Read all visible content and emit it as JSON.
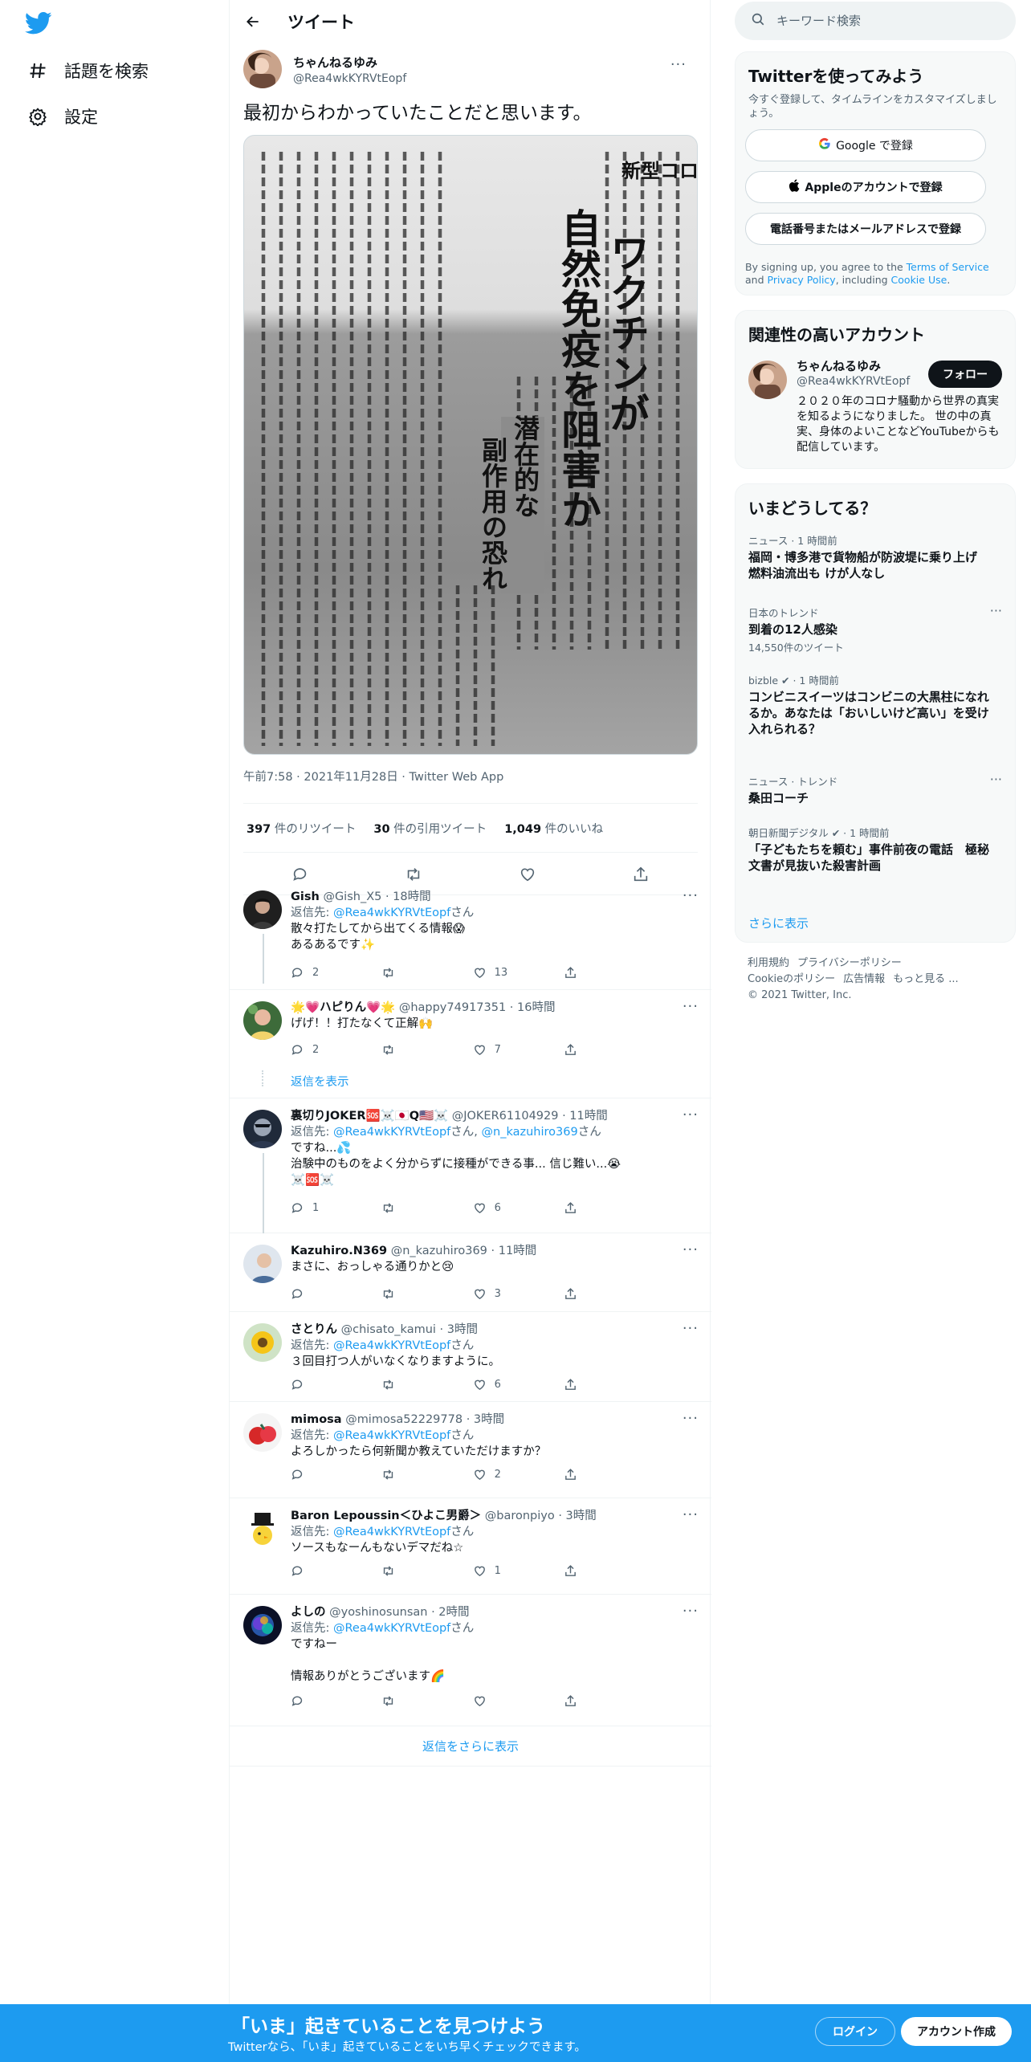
{
  "nav": {
    "explore_label": "話題を検索",
    "settings_label": "設定"
  },
  "header": {
    "title": "ツイート"
  },
  "main_tweet": {
    "name": "ちゃんねるゆみ",
    "handle": "@Rea4wkKYRVtEopf",
    "text": "最初からわかっていたことだと思います。",
    "image": {
      "kicker": "新型コロナ",
      "headline": [
        "ワクチンが",
        "自然免疫を阻害か"
      ],
      "subhead": [
        "潜在的な",
        "副作用の恐れ"
      ],
      "body_text": "スウェーデン・ストックホルム大学分子生物学部などの研究チームによると、新型コロナウイルスは、感染した人のDNAの修復を損ない、抗体を作る遺伝子の組み換え作用を妨げることが分かった。ヒトを含む脊椎動物は、三つの遺伝子の断片を組み換えて1億種類以上の抗体を作る。"
    },
    "meta": "午前7:58 · 2021年11月28日 · Twitter Web App",
    "stats": {
      "retweets_num": "397",
      "retweets_label": " 件のリツイート",
      "quotes_num": "30",
      "quotes_label": " 件の引用ツイート",
      "likes_num": "1,049",
      "likes_label": " 件のいいね"
    }
  },
  "replies": [
    {
      "name": "Gish",
      "handle": "@Gish_X5",
      "time": " · 18時間",
      "to_prefix": "返信先: ",
      "to": "@Rea4wkKYRVtEopf",
      "to_suffix": "さん",
      "lines": [
        "散々打たしてから出てくる情報😱",
        "あるあるです✨"
      ],
      "reply_count": "2",
      "rt_count": "",
      "like_count": "13"
    },
    {
      "name": "🌟💗ハピりん💗🌟",
      "handle": "@happy74917351",
      "time": " · 16時間",
      "lines": [
        "げげ！！打たなくて正解🙌"
      ],
      "reply_count": "2",
      "rt_count": "",
      "like_count": "7",
      "show_replies": "返信を表示"
    },
    {
      "name": "裏切りJOKER🆘☠️🇯🇵Q🇺🇸☠️",
      "handle": "@JOKER61104929",
      "time": " · 11時間",
      "to_prefix": "返信先: ",
      "to": "@Rea4wkKYRVtEopf",
      "to_suffix": "さん, ",
      "to2": "@n_kazuhiro369",
      "to2_suffix": "さん",
      "lines": [
        "ですね...💦",
        "治験中のものをよく分からずに接種ができる事... 信じ難い...😭",
        "☠️🆘☠️"
      ],
      "reply_count": "1",
      "rt_count": "",
      "like_count": "6"
    },
    {
      "name": "Kazuhiro.N369",
      "handle": "@n_kazuhiro369",
      "time": " · 11時間",
      "lines": [
        "まさに、おっしゃる通りかと😢"
      ],
      "reply_count": "",
      "rt_count": "",
      "like_count": "3"
    },
    {
      "name": "さとりん",
      "handle": "@chisato_kamui",
      "time": " · 3時間",
      "to_prefix": "返信先: ",
      "to": "@Rea4wkKYRVtEopf",
      "to_suffix": "さん",
      "lines": [
        "３回目打つ人がいなくなりますように。"
      ],
      "reply_count": "",
      "rt_count": "",
      "like_count": "6"
    },
    {
      "name": "mimosa",
      "handle": "@mimosa52229778",
      "time": " · 3時間",
      "to_prefix": "返信先: ",
      "to": "@Rea4wkKYRVtEopf",
      "to_suffix": "さん",
      "lines": [
        "よろしかったら何新聞か教えていただけますか？"
      ],
      "reply_count": "",
      "rt_count": "",
      "like_count": "2"
    },
    {
      "name": "Baron Lepoussin＜ひよこ男爵＞",
      "handle": "@baronpiyo",
      "time": " · 3時間",
      "to_prefix": "返信先: ",
      "to": "@Rea4wkKYRVtEopf",
      "to_suffix": "さん",
      "lines": [
        "ソースもなーんもないデマだね☆"
      ],
      "reply_count": "",
      "rt_count": "",
      "like_count": "1"
    },
    {
      "name": "よしの",
      "handle": "@yoshinosunsan",
      "time": " · 2時間",
      "to_prefix": "返信先: ",
      "to": "@Rea4wkKYRVtEopf",
      "to_suffix": "さん",
      "lines": [
        "ですねー",
        "",
        "情報ありがとうございます🌈"
      ],
      "reply_count": "",
      "rt_count": "",
      "like_count": ""
    }
  ],
  "more_replies": "返信をさらに表示",
  "search": {
    "placeholder": "キーワード検索"
  },
  "signup_card": {
    "title": "Twitterを使ってみよう",
    "subtitle": "今すぐ登録して、タイムラインをカスタマイズしましょう。",
    "google_label": "Google で登録",
    "apple_label": "Appleのアカウントで登録",
    "phone_label": "電話番号またはメールアドレスで登録",
    "terms_pre": "By signing up, you agree to the ",
    "terms_link": "Terms of Service",
    "terms_mid": " and ",
    "privacy_link": "Privacy Policy",
    "terms_mid2": ", including ",
    "cookie_link": "Cookie Use",
    "terms_end": "."
  },
  "related": {
    "title": "関連性の高いアカウント",
    "name": "ちゃんねるゆみ",
    "handle": "@Rea4wkKYRVtEopf",
    "follow_label": "フォロー",
    "bio": "２０２０年のコロナ騒動から世界の真実を知るようになりました。 世の中の真実、身体のよいことなどYouTubeからも配信しています。"
  },
  "trends": {
    "title": "いまどうしてる？",
    "items": [
      {
        "cat": "ニュース · 1 時間前",
        "title": "福岡・博多港で貨物船が防波堤に乗り上げ 燃料油流出も けが人なし",
        "count": ""
      },
      {
        "cat": "日本のトレンド",
        "title": "到着の12人感染",
        "count": "14,550件のツイート"
      },
      {
        "cat": "bizble ✔ · 1 時間前",
        "title": "コンビニスイーツはコンビニの大黒柱になれるか。あなたは「おいしいけど高い」を受け入れられる？",
        "count": ""
      },
      {
        "cat": "ニュース · トレンド",
        "title": "桑田コーチ",
        "count": ""
      },
      {
        "cat": "朝日新聞デジタル ✔ · 1 時間前",
        "title": "「子どもたちを頼む」事件前夜の電話　極秘文書が見抜いた殺害計画",
        "count": ""
      }
    ],
    "show_more": "さらに表示"
  },
  "footer": {
    "links1": [
      "利用規約",
      "プライバシーポリシー"
    ],
    "links2": [
      "Cookieのポリシー",
      "広告情報",
      "もっと見る ..."
    ],
    "copyright": "© 2021 Twitter, Inc."
  },
  "bottom_bar": {
    "title": "「いま」起きていることを見つけよう",
    "subtitle": "Twitterなら、「いま」起きていることをいち早くチェックできます。",
    "login": "ログイン",
    "signup": "アカウント作成"
  },
  "colors": {
    "accent": "#1d9bf0",
    "text": "#0f1419",
    "muted": "#536471"
  }
}
